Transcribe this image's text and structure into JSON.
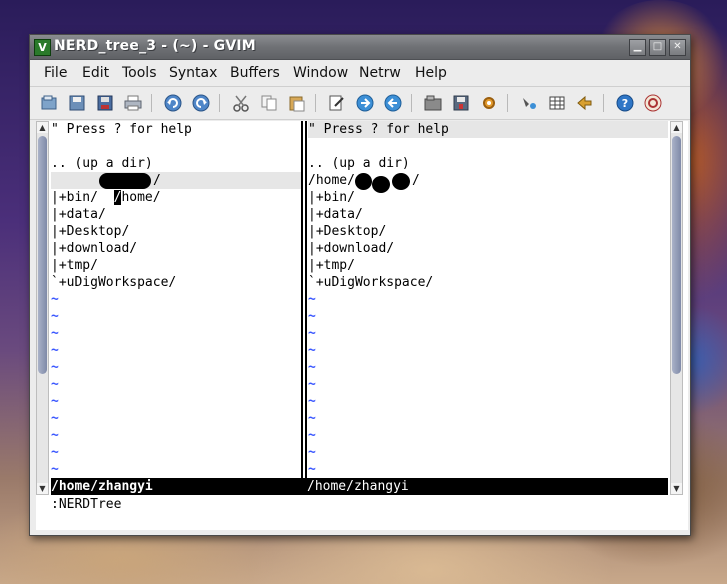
{
  "window": {
    "title": "NERD_tree_3 - (~) - GVIM",
    "app_icon": "V",
    "controls": {
      "minimize": "▁",
      "maximize": "□",
      "close": "✕"
    }
  },
  "menubar": {
    "items": [
      "File",
      "Edit",
      "Tools",
      "Syntax",
      "Buffers",
      "Window",
      "Netrw",
      "Help"
    ]
  },
  "toolbar": {
    "icons": [
      "open-icon",
      "save-icon",
      "save-all-icon",
      "print-icon",
      "undo-icon",
      "redo-icon",
      "cut-icon",
      "copy-icon",
      "paste-icon",
      "find-replace-icon",
      "find-next-icon",
      "find-prev-icon",
      "load-session-icon",
      "save-session-icon",
      "run-script-icon",
      "make-icon",
      "build-tags-icon",
      "jump-tag-icon",
      "help-icon",
      "find-help-icon"
    ]
  },
  "left_pane": {
    "lines": [
      "\" Press ? for help",
      "",
      ".. (up a dir)",
      "/home/",
      "|+bin/",
      "|+data/",
      "|+Desktop/",
      "|+download/",
      "|+tmp/",
      "`+uDigWorkspace/"
    ],
    "cursor_char": "/",
    "home_suffix": "/",
    "tilde": "~",
    "tilde_count": 11
  },
  "right_pane": {
    "lines": [
      "\" Press ? for help",
      "",
      ".. (up a dir)",
      "/home/",
      "|+bin/",
      "|+data/",
      "|+Desktop/",
      "|+download/",
      "|+tmp/",
      "`+uDigWorkspace/"
    ],
    "home_suffix": "/",
    "tilde": "~",
    "tilde_count": 11
  },
  "statusline": {
    "left": "/home/zhangyi",
    "right": "/home/zhangyi"
  },
  "cmdline": {
    "text": ":NERDTree"
  },
  "colors": {
    "tilde": "#3a57ff",
    "statusline_bg": "#000000",
    "highlight_line": "#e6e6e6"
  }
}
